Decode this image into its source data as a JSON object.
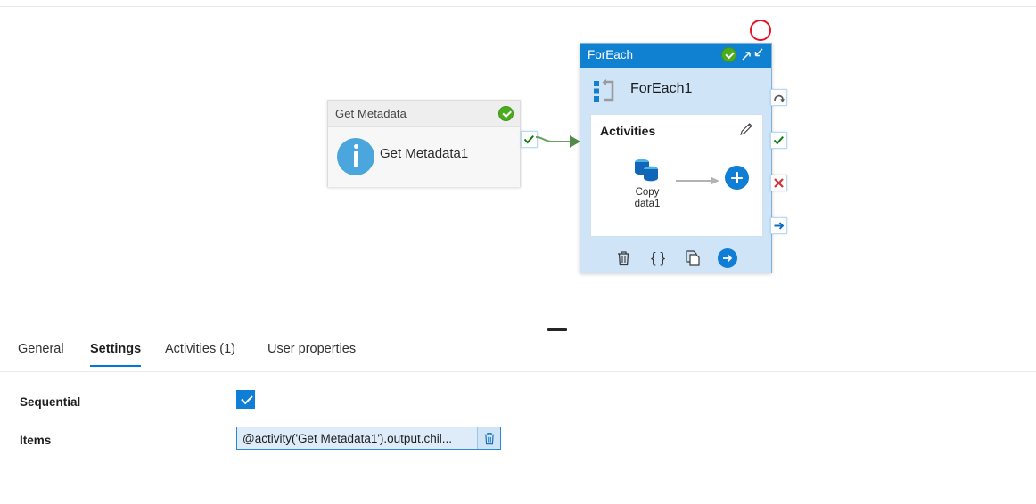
{
  "canvas": {
    "get_metadata": {
      "header_title": "Get Metadata",
      "activity_name": "Get Metadata1",
      "status_icon": "green-check-badge",
      "info_icon": "info-icon",
      "success_handle_icon": "green-check-handle-icon"
    },
    "foreach": {
      "header_title": "ForEach",
      "activity_name": "ForEach1",
      "status_icon": "green-check-badge",
      "expand_icon": "expand-collapse-arrows-icon",
      "loop_icon": "foreach-loop-icon",
      "activities_label": "Activities",
      "edit_icon": "pencil-icon",
      "inner_activity": {
        "label_line1": "Copy",
        "label_line2": "data1",
        "icon": "copy-data-database-icon"
      },
      "add_button_icon": "plus-icon",
      "footer_icons": [
        {
          "name": "delete-icon",
          "glyph": "trash"
        },
        {
          "name": "code-braces-icon",
          "glyph": "{ }"
        },
        {
          "name": "duplicate-icon",
          "glyph": "copy"
        },
        {
          "name": "run-arrow-icon",
          "glyph": "arrow-right-circle"
        }
      ],
      "output_handles": [
        {
          "name": "handle-skipped",
          "icon": "curved-arrow-icon"
        },
        {
          "name": "handle-success",
          "icon": "green-check-icon"
        },
        {
          "name": "handle-failure",
          "icon": "red-x-icon"
        },
        {
          "name": "handle-completion",
          "icon": "blue-arrow-icon"
        }
      ]
    },
    "annotation": {
      "name": "red-circle-highlight"
    },
    "connector": {
      "name": "success-connector-arrow",
      "color": "#6a9f62"
    }
  },
  "properties": {
    "tabs": [
      {
        "label": "General",
        "active": false
      },
      {
        "label": "Settings",
        "active": true
      },
      {
        "label": "Activities (1)",
        "active": false
      },
      {
        "label": "User properties",
        "active": false
      }
    ],
    "fields": {
      "sequential_label": "Sequential",
      "sequential_checked": true,
      "items_label": "Items",
      "items_value": "@activity('Get Metadata1').output.chil...",
      "items_delete_icon": "trash-icon"
    }
  },
  "colors": {
    "accent": "#0f7ed4",
    "foreach_header": "#1081d0",
    "foreach_body": "#cfe4f7",
    "success_green": "#4cac1f",
    "failure_red": "#e81123",
    "annotation_red": "#e81123"
  }
}
